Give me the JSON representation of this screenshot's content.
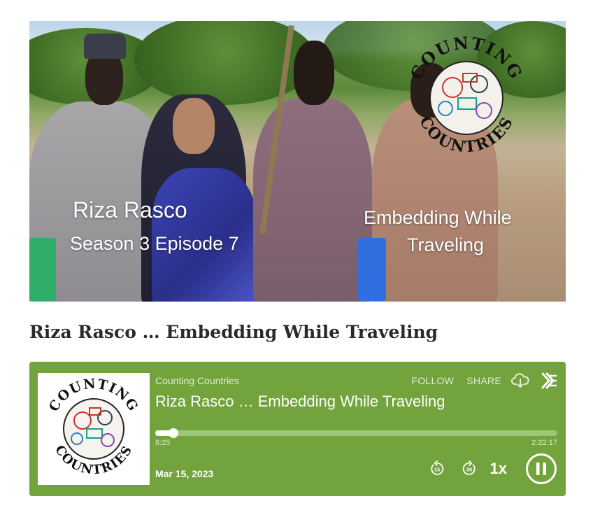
{
  "hero": {
    "guest_name": "Riza Rasco",
    "season_episode": "Season 3 Episode 7",
    "topic_line1": "Embedding While",
    "topic_line2": "Traveling",
    "logo_top": "COUNTING",
    "logo_bottom": "COUNTRIES"
  },
  "page": {
    "episode_title": "Riza Rasco … Embedding While Traveling"
  },
  "player": {
    "show_name": "Counting Countries",
    "episode_name": "Riza Rasco … Embedding While Traveling",
    "follow_label": "FOLLOW",
    "share_label": "SHARE",
    "elapsed": "6:25",
    "duration": "2:22:17",
    "progress_fraction": 0.045,
    "date": "Mar 15, 2023",
    "speed": "1x",
    "skip_back_seconds": "15",
    "skip_forward_seconds": "30",
    "cover_top": "COUNTING",
    "cover_bottom": "COUNTRIES",
    "accent_color": "#72a33c"
  },
  "icons": {
    "download": "download-cloud-icon",
    "brand": "podcast-brand-icon",
    "rewind": "rewind-15-icon",
    "forward": "forward-30-icon",
    "pause": "pause-icon"
  }
}
